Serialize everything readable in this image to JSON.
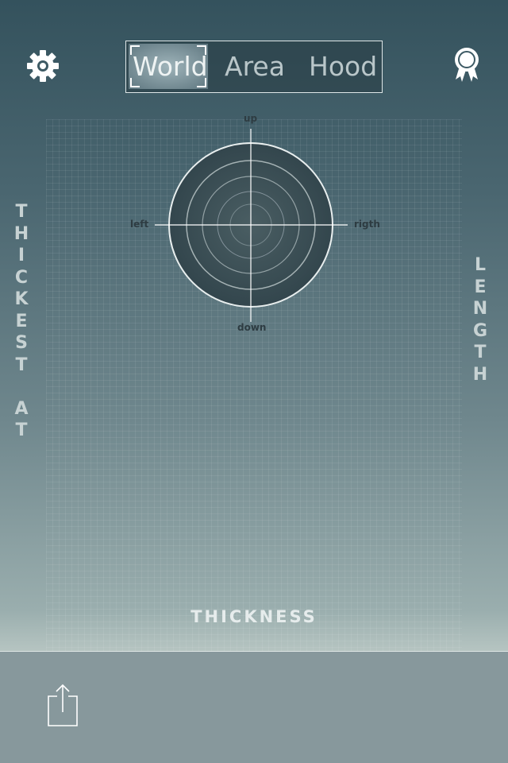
{
  "header": {
    "settings_icon": "gear-icon",
    "award_icon": "ribbon-award-icon",
    "tabs": [
      {
        "label": "World",
        "selected": true
      },
      {
        "label": "Area",
        "selected": false
      },
      {
        "label": "Hood",
        "selected": false
      }
    ]
  },
  "radar": {
    "up": "up",
    "down": "down",
    "left": "left",
    "right": "rigth"
  },
  "labels": {
    "left_vertical": "THICKEST AT",
    "right_vertical": "LENGTH",
    "bottom": "THICKNESS"
  },
  "footer": {
    "share_icon": "share-icon"
  }
}
